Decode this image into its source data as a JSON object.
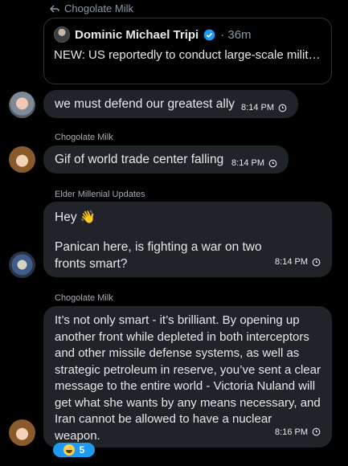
{
  "reply_header": {
    "name": "Chogolate Milk"
  },
  "quote": {
    "author": "Dominic Michael Tripi",
    "meta": "· 36m",
    "text": "NEW: US reportedly to conduct large-scale military operation against Ansar Allah (Houthis..."
  },
  "messages": [
    {
      "sender": "",
      "text": "we must defend our greatest ally",
      "time": "8:14 PM"
    },
    {
      "sender": "Chogolate Milk",
      "text": "Gif of world trade center falling",
      "time": "8:14 PM"
    },
    {
      "sender": "Elder Millenial Updates",
      "line1": "Hey 👋",
      "line2": "Panican here, is fighting a war on two fronts smart?",
      "time": "8:14 PM"
    },
    {
      "sender": "Chogolate Milk",
      "text": "It’s not only smart - it’s brilliant.  By opening up another front while depleted in both interceptors and other missile defense systems, as well as strategic petroleum in reserve, you’ve sent a clear message to the entire world - Victoria Nuland will get what she wants by any means necessary, and Iran cannot be allowed to have a nuclear weapon.",
      "time": "8:16 PM"
    }
  ],
  "reaction": {
    "emoji": "😂",
    "count": "5"
  },
  "colors": {
    "background": "#000000",
    "bubble": "#202327",
    "accent": "#1d9bf0",
    "muted": "#8b98a5"
  }
}
